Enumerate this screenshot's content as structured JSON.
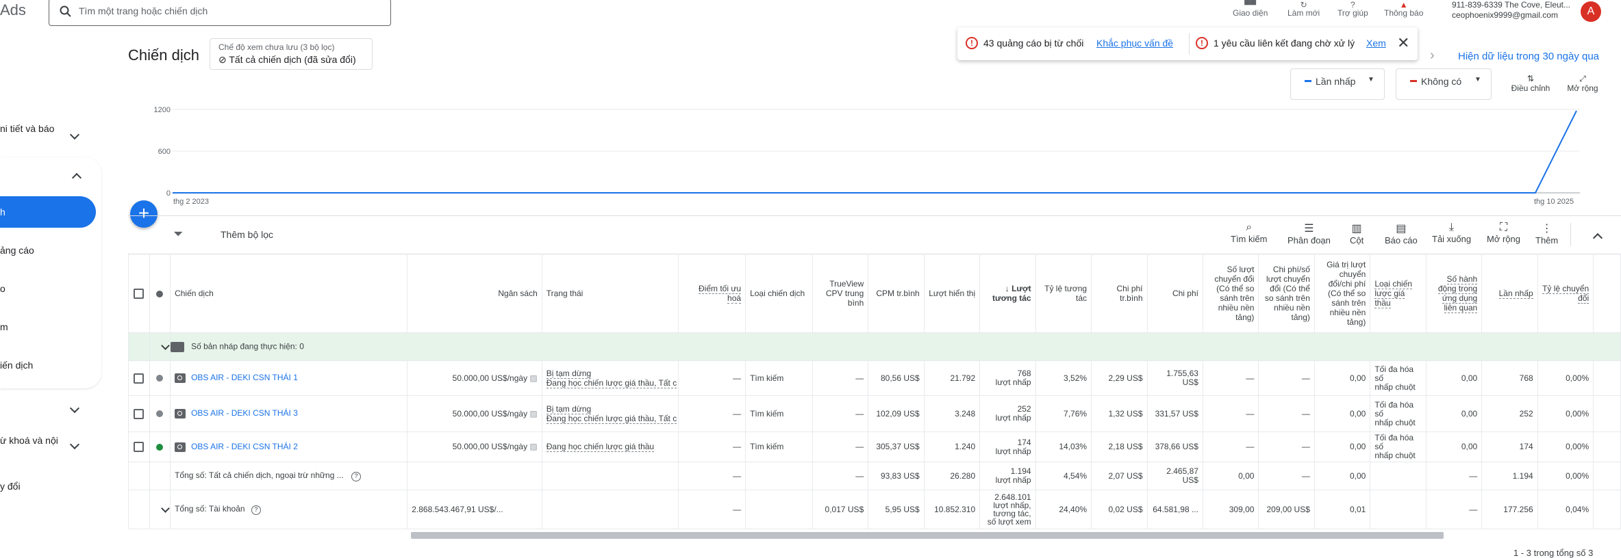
{
  "header": {
    "brand": "Ads",
    "search_placeholder": "Tìm một trang hoặc chiến dịch",
    "tools": [
      {
        "label": "Giao diện",
        "icon": "appearance-icon"
      },
      {
        "label": "Làm mới",
        "icon": "refresh-icon"
      },
      {
        "label": "Trợ giúp",
        "icon": "help-icon"
      },
      {
        "label": "Thông báo",
        "icon": "bell-icon"
      }
    ],
    "account_line1": "911-839-6339 The Cove, Eleut...",
    "account_line2": "ceophoenix9999@gmail.com",
    "avatar_letter": "A"
  },
  "sidebar": {
    "items": [
      {
        "label": "ni tiết và báo"
      },
      {
        "label": "h"
      },
      {
        "label": "ảng cáo"
      },
      {
        "label": "o"
      },
      {
        "label": "m"
      },
      {
        "label": "iến dịch"
      },
      {
        "label": "ừ khoá và nội"
      },
      {
        "label": "y đổi"
      }
    ]
  },
  "page": {
    "title": "Chiến dịch",
    "view_chip_line1": "Chế độ xem chưa lưu (3 bộ lọc)",
    "view_chip_line2": "Tất cả chiến dịch (đã sửa đổi)",
    "data_30_days": "Hiện dữ liệu trong 30 ngày qua"
  },
  "notifications": {
    "n1_text": "43 quảng cáo bị từ chối",
    "n1_link": "Khắc phục vấn đề",
    "n2_text": "1 yêu cầu liên kết đang chờ xử lý",
    "n2_link": "Xem"
  },
  "chart_controls": {
    "metric1": "Lần nhấp",
    "metric2": "Không có",
    "adjust": "Điều chỉnh",
    "expand": "Mở rộng"
  },
  "chart_data": {
    "type": "line",
    "x": [
      "thg 2 2023",
      "thg 10 2025"
    ],
    "yticks": [
      0,
      600,
      1200
    ],
    "ylim": [
      0,
      1200
    ],
    "series": [
      {
        "name": "Lần nhấp",
        "color": "#1a73e8"
      }
    ]
  },
  "toolbar": {
    "add_filter": "Thêm bộ lọc",
    "buttons": [
      {
        "label": "Tìm kiếm",
        "icon": "search-icon"
      },
      {
        "label": "Phân đoạn",
        "icon": "segment-icon"
      },
      {
        "label": "Cột",
        "icon": "columns-icon"
      },
      {
        "label": "Báo cáo",
        "icon": "report-icon"
      },
      {
        "label": "Tải xuống",
        "icon": "download-icon"
      },
      {
        "label": "Mở rộng",
        "icon": "fullscreen-icon"
      },
      {
        "label": "Thêm",
        "icon": "more-icon"
      }
    ]
  },
  "table": {
    "headers": {
      "campaign": "Chiến dịch",
      "budget": "Ngân sách",
      "status": "Trạng thái",
      "opt_score": "Điểm tối ưu hoá",
      "type": "Loại chiến dịch",
      "cpv": "TrueView CPV trung bình",
      "cpm": "CPM tr.bình",
      "impr": "Lượt hiển thị",
      "interactions": "Lượt tương tác",
      "int_rate": "Tỷ lệ tương tác",
      "avg_cost": "Chi phí tr.bình",
      "cost": "Chi phí",
      "conv_cross": "Số lượt chuyển đổi (Có thể so sánh trên nhiều nền tảng)",
      "cost_conv_cross": "Chi phí/số lượt chuyển đổi (Có thể so sánh trên nhiều nền tảng)",
      "value_cost_cross": "Giá trị lượt chuyển đổi/chi phí (Có thể so sánh trên nhiều nền tảng)",
      "bid_type": "Loại chiến lược giá thầu",
      "app_actions": "Số hành động trong ứng dụng liên quan",
      "clicks": "Lần nhấp",
      "conv_rate": "Tỷ lệ chuyển đổi"
    },
    "drafts_row": "Số bản nháp đang thực hiện: 0",
    "rows": [
      {
        "name": "OBS AIR - DEKI CSN THÁI 1",
        "budget": "50.000,00 US$/ngày",
        "status1": "Bị tạm dừng",
        "status2": "Đang học chiến lược giá thầu, Tất c",
        "opt": "—",
        "type": "Tìm kiếm",
        "cpv": "—",
        "cpm": "80,56 US$",
        "impr": "21.792",
        "inter1": "768",
        "inter2": "lượt nhấp",
        "rate": "3,52%",
        "avg": "2,29 US$",
        "cost": "1.755,63 US$",
        "conv": "—",
        "cpc": "—",
        "val": "0,00",
        "bid1": "Tối đa hóa số",
        "bid2": "nhấp chuột",
        "app": "0,00",
        "clicks": "768",
        "cr": "0,00%",
        "dot": "#80868b"
      },
      {
        "name": "OBS AIR - DEKI CSN THÁI 3",
        "budget": "50.000,00 US$/ngày",
        "status1": "Bị tạm dừng",
        "status2": "Đang học chiến lược giá thầu, Tất c",
        "opt": "—",
        "type": "Tìm kiếm",
        "cpv": "—",
        "cpm": "102,09 US$",
        "impr": "3.248",
        "inter1": "252",
        "inter2": "lượt nhấp",
        "rate": "7,76%",
        "avg": "1,32 US$",
        "cost": "331,57 US$",
        "conv": "—",
        "cpc": "—",
        "val": "0,00",
        "bid1": "Tối đa hóa số",
        "bid2": "nhấp chuột",
        "app": "0,00",
        "clicks": "252",
        "cr": "0,00%",
        "dot": "#80868b"
      },
      {
        "name": "OBS AIR - DEKI  CSN THÁI 2",
        "budget": "50.000,00 US$/ngày",
        "status1": "Đang học chiến lược giá thầu",
        "status2": "",
        "opt": "—",
        "type": "Tìm kiếm",
        "cpv": "—",
        "cpm": "305,37 US$",
        "impr": "1.240",
        "inter1": "174",
        "inter2": "lượt nhấp",
        "rate": "14,03%",
        "avg": "2,18 US$",
        "cost": "378,66 US$",
        "conv": "—",
        "cpc": "—",
        "val": "0,00",
        "bid1": "Tối đa hóa số",
        "bid2": "nhấp chuột",
        "app": "0,00",
        "clicks": "174",
        "cr": "0,00%",
        "dot": "#1e8e3e"
      }
    ],
    "total1": {
      "label": "Tổng số: Tất cả chiến dịch, ngoại trừ những ...",
      "opt": "—",
      "cpv": "—",
      "cpm": "93,83 US$",
      "impr": "26.280",
      "inter1": "1.194",
      "inter2": "lượt nhấp",
      "rate": "4,54%",
      "avg": "2,07 US$",
      "cost": "2.465,87 US$",
      "conv": "0,00",
      "cpc": "—",
      "val": "0,00",
      "app": "—",
      "clicks": "1.194",
      "cr": "0,00%"
    },
    "total2": {
      "label": "Tổng số: Tài khoản",
      "budget": "2.868.543.467,91 US$/...",
      "opt": "—",
      "cpv": "0,017 US$",
      "cpm": "5,95 US$",
      "impr": "10.852.310",
      "inter1": "2.648.101",
      "inter2": "lượt nhấp,",
      "inter3": "tương tác,",
      "inter4": "số lượt xem",
      "rate": "24,40%",
      "avg": "0,02 US$",
      "cost": "64.581,98 ...",
      "conv": "309,00",
      "cpc": "209,00 US$",
      "val": "0,01",
      "app": "—",
      "clicks": "177.256",
      "cr": "0,04%"
    }
  },
  "pagination": "1 - 3 trong tổng số 3"
}
